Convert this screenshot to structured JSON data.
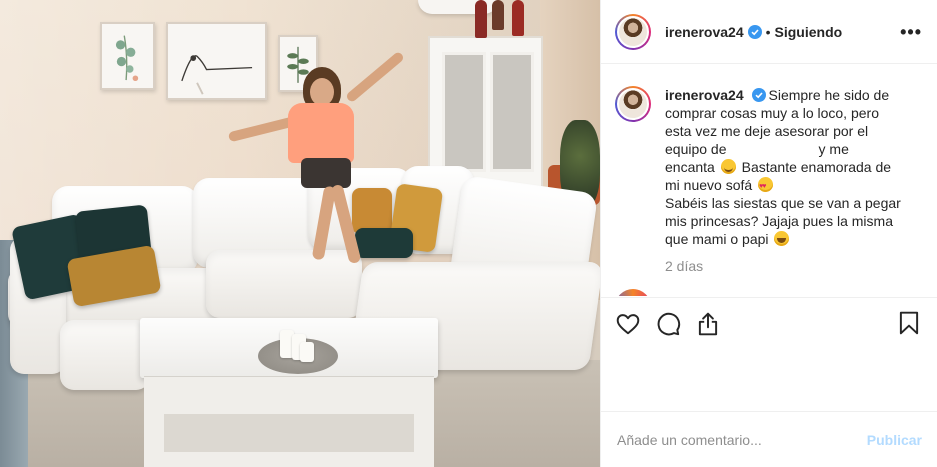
{
  "post": {
    "username": "irenerova24",
    "verified": true,
    "separator": "•",
    "follow_status": "Siguiendo",
    "more_label": "•••"
  },
  "caption": {
    "username": "irenerova24",
    "line1": "Siempre he sido de",
    "line2": "comprar cosas muy a lo loco, pero",
    "line3": "esta vez me deje asesorar por el",
    "line4a": "equipo de",
    "line4b": "y me",
    "line5a": "encanta",
    "line5b": "Bastante enamorada de",
    "line6": "mi nuevo sofá",
    "line7": "Sabéis las siestas que se van a pegar",
    "line8": "mis princesas? Jajaja pues la misma",
    "line9": "que mami o papi",
    "emoji_1": "smiling-face-icon",
    "emoji_2": "heart-eyes-icon",
    "emoji_3": "laughing-face-icon"
  },
  "time_ago": "2 días",
  "actions": {
    "like_icon": "heart-outline-icon",
    "comment_icon": "comment-bubble-icon",
    "share_icon": "share-icon",
    "save_icon": "bookmark-icon"
  },
  "comment_box": {
    "placeholder": "Añade un comentario...",
    "value": "",
    "publish_label": "Publicar"
  },
  "colors": {
    "verified_blue": "#3897f0",
    "text": "#262626",
    "muted": "#8e8e8e",
    "publish_disabled": "#b3dbff",
    "border": "#efefef"
  }
}
